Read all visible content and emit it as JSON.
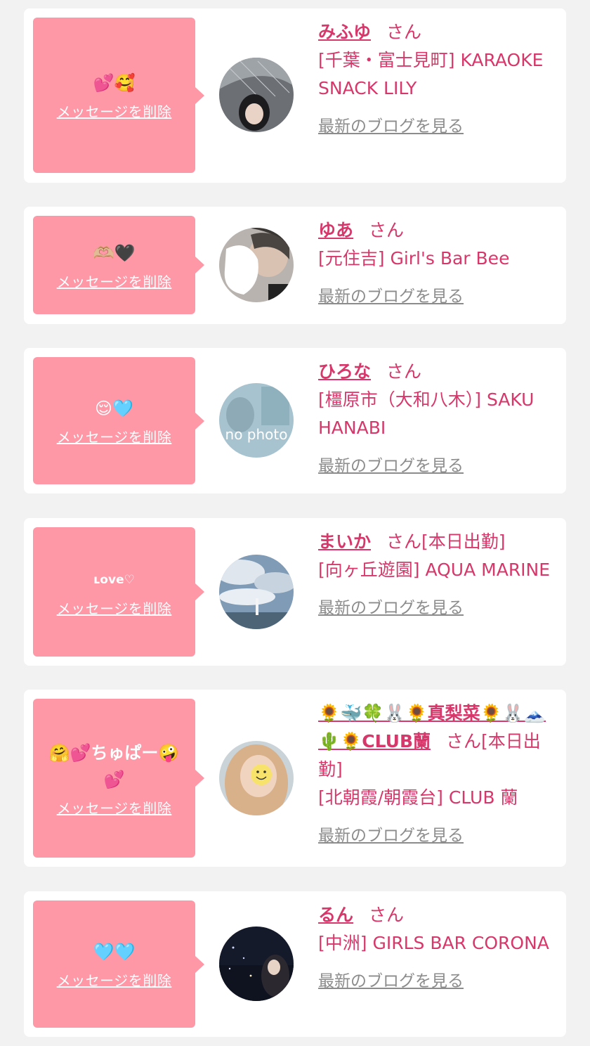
{
  "common": {
    "delete_label": "メッセージを削除",
    "blog_label": "最新のブログを見る",
    "san": "さん"
  },
  "items": [
    {
      "message": "💕🥰",
      "name": "みふゆ",
      "tag": "",
      "shop": "[千葉・富士見町] KARAOKE SNACK LILY"
    },
    {
      "message": "🫶🏼🖤",
      "name": "ゆあ",
      "tag": "",
      "shop": "[元住吉] Girl's Bar Bee"
    },
    {
      "message": "😌🩵",
      "name": "ひろな",
      "tag": "",
      "shop": "[橿原市（大和八木）] SAKU HANABI",
      "avatar_text": "no photo"
    },
    {
      "message": "ʟove♡",
      "name": "まいか",
      "tag": "[本日出勤]",
      "shop": "[向ヶ丘遊園] AQUA MARINE"
    },
    {
      "message": "🤗💕ちゅぱー🤪\n💕",
      "name": "🌻🐳🍀🐰🌻真梨菜🌻🐰🗻🌵🌻CLUB蘭",
      "tag": "[本日出勤]",
      "shop": "[北朝霞/朝霞台] CLUB 蘭"
    },
    {
      "message": "🩵🩵",
      "name": "るん",
      "tag": "",
      "shop": "[中洲] GIRLS BAR CORONA"
    }
  ],
  "colors": {
    "bubble": "#fe97a6",
    "accent": "#d6386b",
    "muted": "#8c8c8c",
    "background": "#f2f2f2"
  }
}
